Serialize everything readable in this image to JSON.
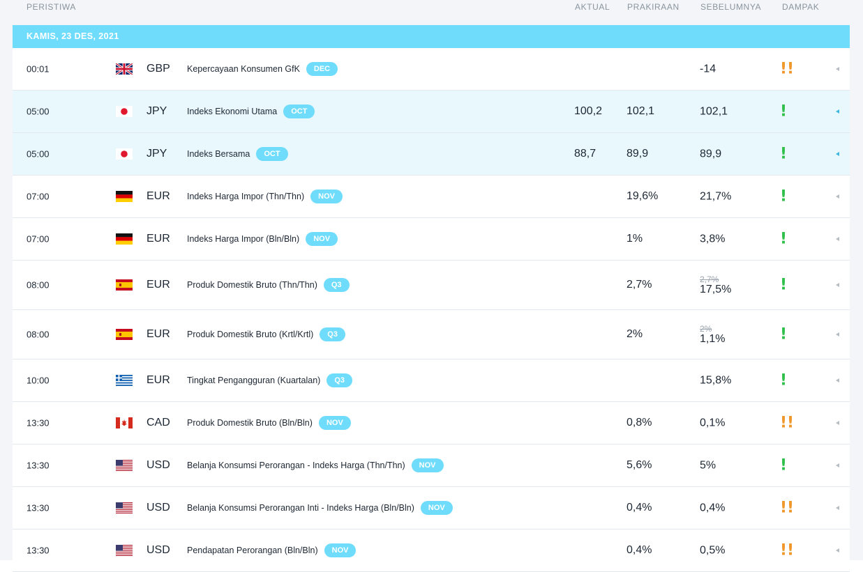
{
  "columns": {
    "event": "PERISTIWA",
    "actual": "AKTUAL",
    "forecast": "PRAKIRAAN",
    "previous": "SEBELUMNYA",
    "impact": "DAMPAK"
  },
  "date_label": "KAMIS, 23 DES, 2021",
  "colors": {
    "accent": "#6fdcfb",
    "impact_low": "#2fbf4a",
    "impact_medium": "#f0972b",
    "row_highlight": "#e9f8fd"
  },
  "rows": [
    {
      "time": "00:01",
      "flag": "gb-flag-icon",
      "currency": "GBP",
      "event": "Kepercayaan Konsumen GfK",
      "period": "DEC",
      "actual": "",
      "forecast": "",
      "previous": "-14",
      "previous_revised_from": "",
      "impact": "!!",
      "impact_level": "medium",
      "highlight": false
    },
    {
      "time": "05:00",
      "flag": "jp-flag-icon",
      "currency": "JPY",
      "event": "Indeks Ekonomi Utama",
      "period": "OCT",
      "actual": "100,2",
      "forecast": "102,1",
      "previous": "102,1",
      "previous_revised_from": "",
      "impact": "!",
      "impact_level": "low",
      "highlight": true
    },
    {
      "time": "05:00",
      "flag": "jp-flag-icon",
      "currency": "JPY",
      "event": "Indeks Bersama",
      "period": "OCT",
      "actual": "88,7",
      "forecast": "89,9",
      "previous": "89,9",
      "previous_revised_from": "",
      "impact": "!",
      "impact_level": "low",
      "highlight": true
    },
    {
      "time": "07:00",
      "flag": "de-flag-icon",
      "currency": "EUR",
      "event": "Indeks Harga Impor (Thn/Thn)",
      "period": "NOV",
      "actual": "",
      "forecast": "19,6%",
      "previous": "21,7%",
      "previous_revised_from": "",
      "impact": "!",
      "impact_level": "low",
      "highlight": false
    },
    {
      "time": "07:00",
      "flag": "de-flag-icon",
      "currency": "EUR",
      "event": "Indeks Harga Impor (Bln/Bln)",
      "period": "NOV",
      "actual": "",
      "forecast": "1%",
      "previous": "3,8%",
      "previous_revised_from": "",
      "impact": "!",
      "impact_level": "low",
      "highlight": false
    },
    {
      "time": "08:00",
      "flag": "es-flag-icon",
      "currency": "EUR",
      "event": "Produk Domestik Bruto (Thn/Thn)",
      "period": "Q3",
      "actual": "",
      "forecast": "2,7%",
      "previous": "17,5%",
      "previous_revised_from": "2,7%",
      "impact": "!",
      "impact_level": "low",
      "highlight": false
    },
    {
      "time": "08:00",
      "flag": "es-flag-icon",
      "currency": "EUR",
      "event": "Produk Domestik Bruto (Krtl/Krtl)",
      "period": "Q3",
      "actual": "",
      "forecast": "2%",
      "previous": "1,1%",
      "previous_revised_from": "2%",
      "impact": "!",
      "impact_level": "low",
      "highlight": false
    },
    {
      "time": "10:00",
      "flag": "gr-flag-icon",
      "currency": "EUR",
      "event": "Tingkat Pengangguran (Kuartalan)",
      "period": "Q3",
      "actual": "",
      "forecast": "",
      "previous": "15,8%",
      "previous_revised_from": "",
      "impact": "!",
      "impact_level": "low",
      "highlight": false
    },
    {
      "time": "13:30",
      "flag": "ca-flag-icon",
      "currency": "CAD",
      "event": "Produk Domestik Bruto (Bln/Bln)",
      "period": "NOV",
      "actual": "",
      "forecast": "0,8%",
      "previous": "0,1%",
      "previous_revised_from": "",
      "impact": "!!",
      "impact_level": "medium",
      "highlight": false
    },
    {
      "time": "13:30",
      "flag": "us-flag-icon",
      "currency": "USD",
      "event": "Belanja Konsumsi Perorangan - Indeks Harga (Thn/Thn)",
      "period": "NOV",
      "actual": "",
      "forecast": "5,6%",
      "previous": "5%",
      "previous_revised_from": "",
      "impact": "!",
      "impact_level": "low",
      "highlight": false
    },
    {
      "time": "13:30",
      "flag": "us-flag-icon",
      "currency": "USD",
      "event": "Belanja Konsumsi Perorangan Inti - Indeks Harga (Bln/Bln)",
      "period": "NOV",
      "actual": "",
      "forecast": "0,4%",
      "previous": "0,4%",
      "previous_revised_from": "",
      "impact": "!!",
      "impact_level": "medium",
      "highlight": false
    },
    {
      "time": "13:30",
      "flag": "us-flag-icon",
      "currency": "USD",
      "event": "Pendapatan Perorangan (Bln/Bln)",
      "period": "NOV",
      "actual": "",
      "forecast": "0,4%",
      "previous": "0,5%",
      "previous_revised_from": "",
      "impact": "!!",
      "impact_level": "medium",
      "highlight": false
    }
  ]
}
